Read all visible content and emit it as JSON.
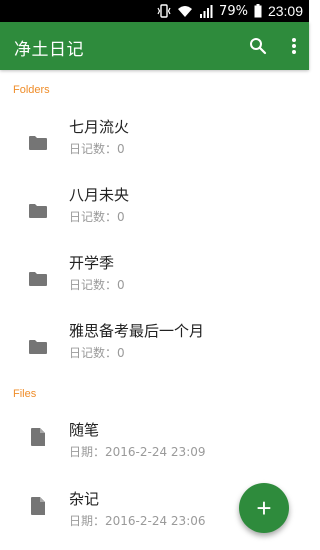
{
  "status_bar": {
    "battery": "79%",
    "time": "23:09"
  },
  "app_bar": {
    "title": "净土日记",
    "search_icon": "search-icon",
    "more_icon": "more-vert-icon"
  },
  "colors": {
    "primary": "#2e8b3c",
    "section_header": "#ef8d2a",
    "title_text": "#222222",
    "secondary_text": "#9a9a9a",
    "icon": "#757575"
  },
  "sections": {
    "folders_label": "Folders",
    "files_label": "Files"
  },
  "folders": [
    {
      "name": "七月流火",
      "count": "日记数：0"
    },
    {
      "name": "八月未央",
      "count": "日记数：0"
    },
    {
      "name": "开学季",
      "count": "日记数：0"
    },
    {
      "name": "雅思备考最后一个月",
      "count": "日记数：0"
    }
  ],
  "files": [
    {
      "name": "随笔",
      "date": "日期：2016-2-24 23:09"
    },
    {
      "name": "杂记",
      "date": "日期：2016-2-24 23:06"
    }
  ],
  "fab": {
    "label": "+"
  }
}
